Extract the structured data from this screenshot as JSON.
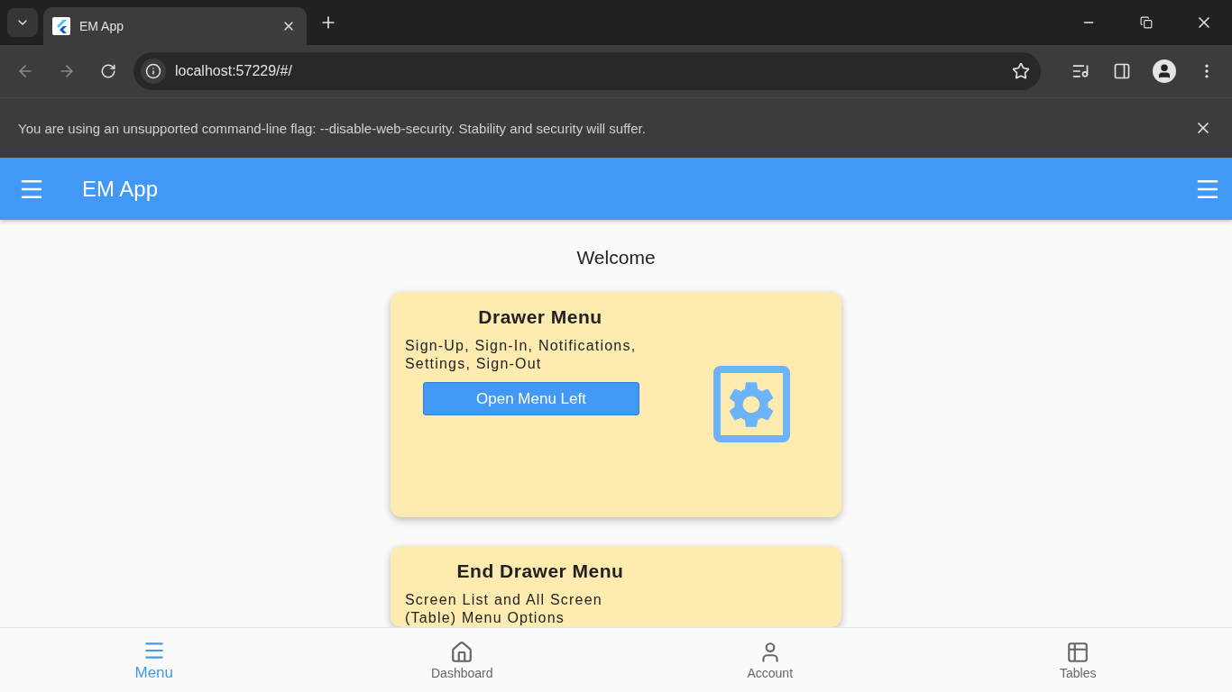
{
  "browser": {
    "tab": {
      "title": "EM App"
    },
    "address": "localhost:57229/#/",
    "infobar": "You are using an unsupported command-line flag: --disable-web-security. Stability and security will suffer."
  },
  "app_bar": {
    "title": "EM App"
  },
  "welcome": "Welcome",
  "cards": [
    {
      "title": "Drawer Menu",
      "description": "Sign-Up, Sign-In, Notifications, Settings, Sign-Out",
      "button": "Open Menu Left",
      "kind": "settings"
    },
    {
      "title": "End Drawer Menu",
      "description": "Screen List and All Screen (Table) Menu Options",
      "kind": "partial"
    }
  ],
  "bottom_nav": [
    {
      "label": "Menu",
      "kind": "menu",
      "selected": true
    },
    {
      "label": "Dashboard",
      "kind": "home",
      "selected": false
    },
    {
      "label": "Account",
      "kind": "person",
      "selected": false
    },
    {
      "label": "Tables",
      "kind": "table",
      "selected": false
    }
  ]
}
